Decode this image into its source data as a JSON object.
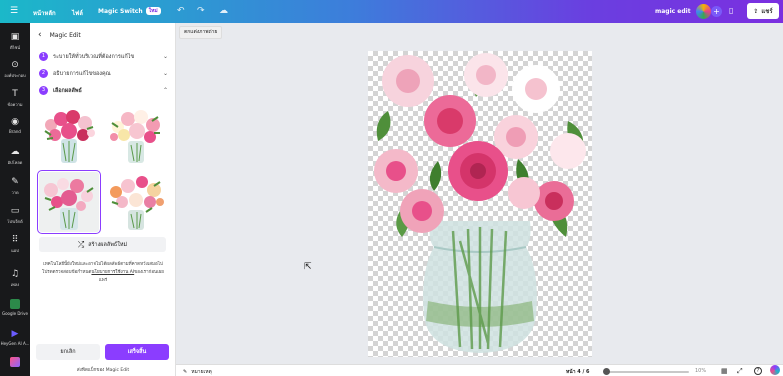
{
  "topbar": {
    "menu_icon": "☰",
    "home": "หน้าหลัก",
    "file": "ไฟล์",
    "magic_switch": "Magic Switch",
    "magic_badge": "ใหม่",
    "undo_icon": "↶",
    "redo_icon": "↷",
    "cloud_icon": "☁",
    "design_title": "magic edit",
    "plus_icon": "+",
    "chart_icon": "▯",
    "share_label": "แชร์",
    "share_icon": "⇪"
  },
  "rail": {
    "items": [
      {
        "label": "ดีไซน์",
        "glyph": "▣"
      },
      {
        "label": "องค์ประกอบ",
        "glyph": "⊙"
      },
      {
        "label": "ข้อความ",
        "glyph": "T"
      },
      {
        "label": "Brand",
        "glyph": "◉"
      },
      {
        "label": "อัปโหลด",
        "glyph": "☁"
      },
      {
        "label": "วาด",
        "glyph": "✎"
      },
      {
        "label": "โปรเจ็กต์",
        "glyph": "▭"
      },
      {
        "label": "แอป",
        "glyph": "⠿"
      },
      {
        "label": "เพลง",
        "glyph": "♫"
      },
      {
        "label": "Google Drive",
        "glyph": ""
      },
      {
        "label": "HeyGen AI A...",
        "glyph": "▶"
      },
      {
        "label": "",
        "glyph": ""
      }
    ]
  },
  "panel": {
    "back_icon": "‹",
    "title": "Magic Edit",
    "steps": [
      {
        "num": "1",
        "label": "ระบายให้ทั่วบริเวณที่ต้องการแก้ไข",
        "chevron": "⌄"
      },
      {
        "num": "2",
        "label": "อธิบายการแก้ไขของคุณ",
        "chevron": "⌄"
      },
      {
        "num": "3",
        "label": "เลือกผลลัพธ์",
        "chevron": "⌃"
      }
    ],
    "regenerate_icon": "⤮",
    "regenerate_label": "สร้างผลลัพธ์ใหม่",
    "disclaimer_pre": "เทคโนโลยีนี้ยังใหม่และอาจไม่ได้ผลลัพธ์ตามที่คาดหวังเสมอไป โปรดตรวจสอบข้อกำหนด",
    "disclaimer_link": "นโยบายการใช้งาน AI",
    "disclaimer_post": "ของเราก่อนเผยแพร่",
    "cancel_label": "ยกเลิก",
    "done_label": "เสร็จสิ้น",
    "feedback": "ส่งฟีดแบ็กของ Magic Edit"
  },
  "context_bar": {
    "label": "ตกแต่งภาพถ่าย"
  },
  "bottombar": {
    "notes_icon": "✎",
    "notes_label": "หมายเหตุ",
    "page_label": "หน้า 4 / 6",
    "zoom_label": "10%",
    "zoom_fraction": 0.1,
    "grid_icon": "▦",
    "fullscreen_icon": "⤢",
    "help_icon": "?"
  },
  "colors": {
    "accent": "#8b3dff",
    "rose_pink": "#e8508a",
    "leaf_green": "#4f8f3a"
  }
}
